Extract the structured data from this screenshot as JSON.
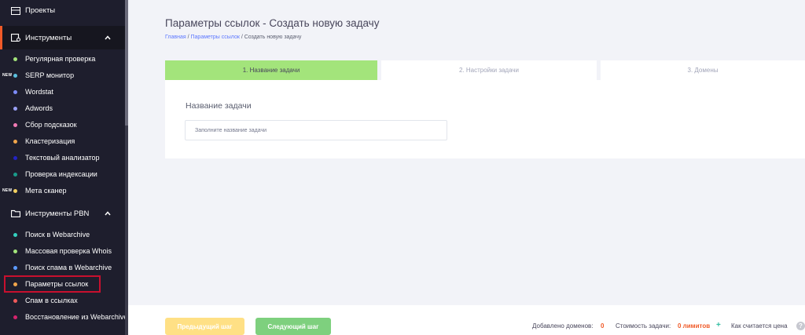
{
  "sidebar": {
    "projects": "Проекты",
    "groups": {
      "tools": "Инструменты",
      "pbn": "Инструменты PBN"
    },
    "new_badge": "NEW",
    "items": [
      {
        "label": "Регулярная проверка",
        "color": "#a3e47b"
      },
      {
        "label": "SERP монитор",
        "color": "#5bc0de"
      },
      {
        "label": "Wordstat",
        "color": "#7d8cf8"
      },
      {
        "label": "Adwords",
        "color": "#9aa0f5"
      },
      {
        "label": "Сбор подсказок",
        "color": "#f27bb5"
      },
      {
        "label": "Кластеризация",
        "color": "#f0a54b"
      },
      {
        "label": "Текстовый анализатор",
        "color": "#2323c4"
      },
      {
        "label": "Проверка индексации",
        "color": "#1a9a8a"
      },
      {
        "label": "Мета сканер",
        "color": "#f2d060"
      }
    ],
    "pbn_items": [
      {
        "label": "Поиск в Webarchive",
        "color": "#34d1bf"
      },
      {
        "label": "Массовая проверка Whois",
        "color": "#a3e47b"
      },
      {
        "label": "Поиск спама в Webarchive",
        "color": "#5d9bff"
      },
      {
        "label": "Параметры ссылок",
        "color": "#f0a54b"
      },
      {
        "label": "Спам в ссылках",
        "color": "#f05a5a"
      },
      {
        "label": "Восстановление из Webarchive",
        "color": "#d6246e"
      }
    ]
  },
  "page": {
    "title": "Параметры ссылок - Создать новую задачу",
    "breadcrumb": {
      "home": "Главная",
      "sep": " / ",
      "section": "Параметры ссылок",
      "current": "Создать новую задачу"
    }
  },
  "steps": [
    {
      "label": "1. Название задачи"
    },
    {
      "label": "2. Настройки задачи"
    },
    {
      "label": "3. Домены"
    }
  ],
  "form": {
    "label": "Название задачи",
    "placeholder": "Заполните название задачи",
    "value": ""
  },
  "footer": {
    "prev": "Предыдущий шаг",
    "next": "Следующий шаг",
    "domains_label": "Добавлено доменов:",
    "domains_value": "0",
    "cost_label": "Стоимость задачи:",
    "cost_value": "0 лимитов",
    "plus": "+",
    "how_label": "Как считается цена",
    "help": "?"
  }
}
